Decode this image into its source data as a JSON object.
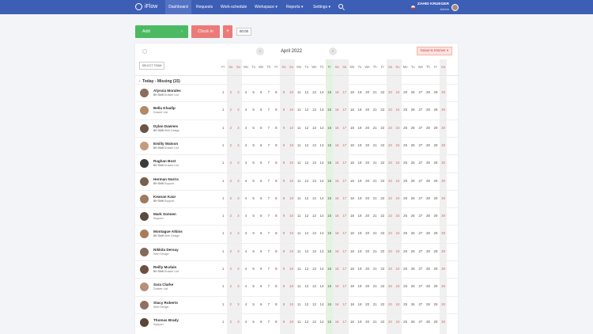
{
  "nav": {
    "brand": "iFlow",
    "items": [
      "Dashboard",
      "Requests",
      "Work-schedule",
      "Workspace",
      "Reports",
      "Settings"
    ],
    "user_name": "ZAHID KRUEGER",
    "user_role": "Admin"
  },
  "actions": {
    "add": "Add",
    "add_arrow": "›",
    "clock_in": "Clock in",
    "plus": "+",
    "timer": "00:00"
  },
  "calendar": {
    "prev": "‹",
    "next": "›",
    "month": "April 2022",
    "status_btn": "TODAY'S STATUS ▼",
    "select_team": "SELECT TEAM",
    "weekdays": [
      "Fr",
      "Sa",
      "Su",
      "Mo",
      "Tu",
      "We",
      "Th",
      "Fr",
      "Sa",
      "Su",
      "Mo",
      "Tu",
      "We",
      "Th",
      "Fr",
      "Sa",
      "Su",
      "Mo",
      "Tu",
      "We",
      "Th",
      "Fr",
      "Sa",
      "Su",
      "Mo",
      "Tu",
      "We",
      "Th",
      "Fr",
      "Sa"
    ],
    "group_caret": "›",
    "group_label": "Today - Missing (15)"
  },
  "employees": [
    {
      "name": "Alyssia Morales",
      "tag": "8H Shift",
      "team": "Drawer List"
    },
    {
      "name": "Bella Khadip",
      "tag": "",
      "team": "Drawer List"
    },
    {
      "name": "Dylan Dawnes",
      "tag": "8H Shift",
      "team": "Web Design"
    },
    {
      "name": "Emilly Watson",
      "tag": "8H Shift",
      "team": "Drawer List"
    },
    {
      "name": "Raghan Bost",
      "tag": "8H Shift",
      "team": "Drawer List"
    },
    {
      "name": "Herman Norris",
      "tag": "8H Shift",
      "team": "Support"
    },
    {
      "name": "Keanan Kaur",
      "tag": "8H Shift",
      "team": "Support"
    },
    {
      "name": "Mark Sonnen",
      "tag": "",
      "team": "Support"
    },
    {
      "name": "Montague Atkins",
      "tag": "8H Shift",
      "team": "Web Design"
    },
    {
      "name": "Nikkita Dersay",
      "tag": "",
      "team": "Web Design"
    },
    {
      "name": "Reilly Mcdain",
      "tag": "8H Shift",
      "team": "Drawer List"
    },
    {
      "name": "Sara Clarke",
      "tag": "",
      "team": "Drawer List"
    },
    {
      "name": "Stacy Roberts",
      "tag": "",
      "team": "Web Design"
    },
    {
      "name": "Thomas Brady",
      "tag": "",
      "team": "Support"
    }
  ],
  "colors": {
    "nav": "#3d5eb5",
    "add": "#4bba63",
    "clock_in": "#ec7a78",
    "weekend": "#d36a5f",
    "today_column": "#e3f3e0"
  }
}
